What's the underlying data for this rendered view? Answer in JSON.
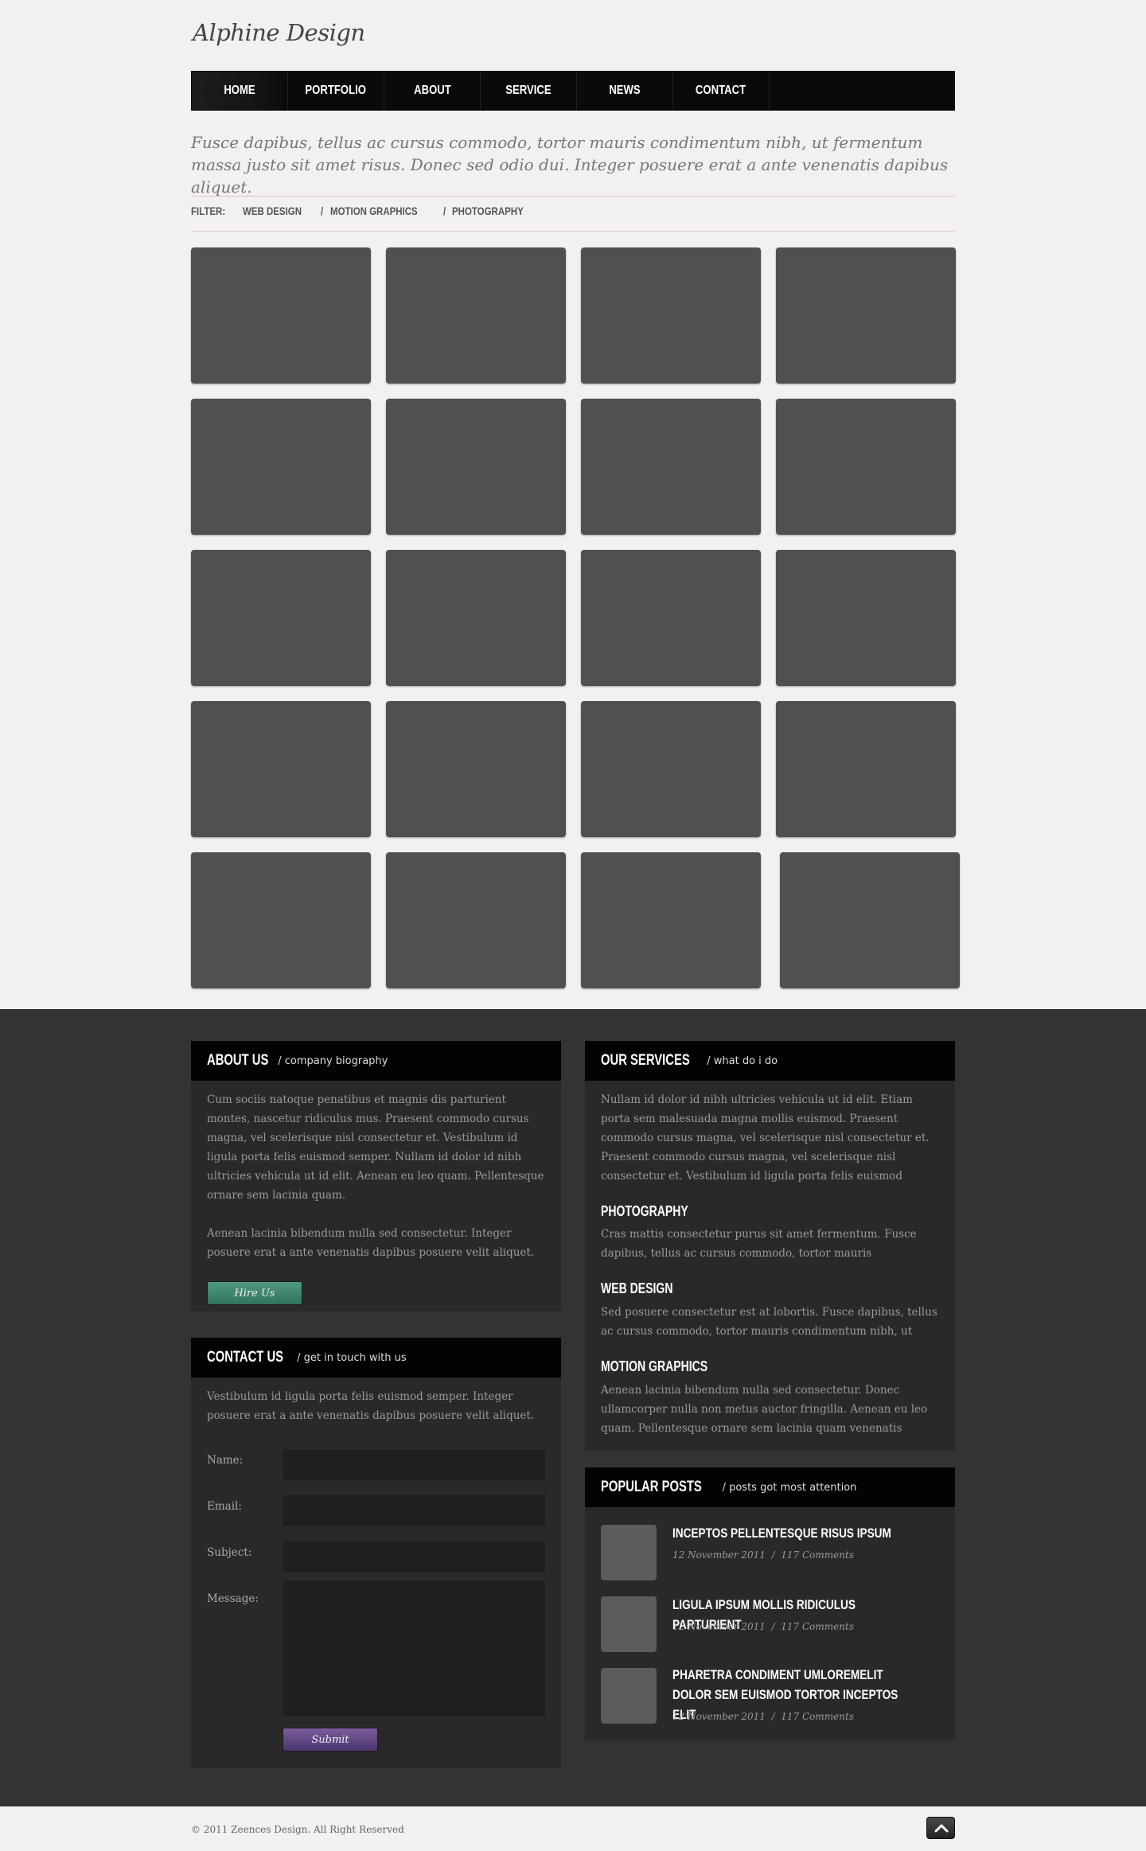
{
  "brand": {
    "logo": "Alphine Design"
  },
  "nav": {
    "items": [
      "HOME",
      "PORTFOLIO",
      "ABOUT",
      "SERVICE",
      "NEWS",
      "CONTACT"
    ],
    "active": "HOME"
  },
  "intro": {
    "text": "Fusce dapibus, tellus ac cursus commodo, tortor mauris condimentum nibh, ut fermentum massa justo sit amet risus. Donec sed odio dui. Integer posuere erat a ante venenatis dapibus aliquet."
  },
  "filter": {
    "label": "FILTER:",
    "options": [
      "WEB DESIGN",
      "MOTION GRAPHICS",
      "PHOTOGRAPHY"
    ],
    "separator": "/"
  },
  "about": {
    "title": "ABOUT US",
    "subtitle": "/  company biography",
    "p1": "Cum sociis natoque penatibus et magnis dis parturient montes, nascetur ridiculus mus. Praesent commodo cursus magna, vel scelerisque nisl consectetur et. Vestibulum id ligula porta felis euismod semper. Nullam id dolor id nibh ultricies vehicula ut id elit. Aenean eu leo quam. Pellentesque ornare sem lacinia quam.",
    "p2": "Aenean lacinia bibendum nulla sed consectetur. Integer posuere erat a ante venenatis dapibus posuere velit aliquet.",
    "button": "Hire Us"
  },
  "contact": {
    "title": "CONTACT US",
    "subtitle": "/  get in touch with us",
    "text": "Vestibulum id ligula porta felis euismod semper. Integer posuere erat a ante venenatis dapibus posuere velit aliquet.",
    "labels": {
      "name": "Name:",
      "email": "Email:",
      "subject": "Subject:",
      "message": "Message:"
    },
    "values": {
      "name": "",
      "email": "",
      "subject": "",
      "message": ""
    },
    "submit": "Submit"
  },
  "services": {
    "title": "OUR SERVICES",
    "subtitle": "/  what do i do",
    "intro": "Nullam id dolor id nibh ultricies vehicula ut id elit. Etiam porta sem malesuada magna mollis euismod. Praesent commodo cursus magna, vel scelerisque nisl consectetur et. Praesent commodo cursus magna, vel scelerisque nisl consectetur et. Vestibulum id ligula porta felis euismod",
    "items": [
      {
        "title": "PHOTOGRAPHY",
        "text": "Cras mattis consectetur purus sit amet fermentum. Fusce dapibus, tellus ac cursus commodo, tortor mauris"
      },
      {
        "title": "WEB DESIGN",
        "text": "Sed posuere consectetur est at lobortis. Fusce dapibus, tellus ac cursus commodo, tortor mauris condimentum nibh, ut"
      },
      {
        "title": "MOTION GRAPHICS",
        "text": "Aenean lacinia bibendum nulla sed consectetur. Donec ullamcorper nulla non metus auctor fringilla. Aenean eu leo quam. Pellentesque ornare sem lacinia quam venenatis"
      }
    ]
  },
  "popular": {
    "title": "POPULAR POSTS",
    "subtitle": "/  posts got most attention",
    "posts": [
      {
        "title": "INCEPTOS PELLENTESQUE RISUS IPSUM",
        "date": "12 November 2011",
        "sep": "/",
        "comments": "117 Comments"
      },
      {
        "title": "LIGULA IPSUM MOLLIS RIDICULUS PARTURIENT",
        "date": "12 November 2011",
        "sep": "/",
        "comments": "117 Comments"
      },
      {
        "title": "PHARETRA CONDIMENT UMLOREMELIT DOLOR SEM EUISMOD TORTOR INCEPTOS ELIT",
        "date": "12 November 2011",
        "sep": "/",
        "comments": "117 Comments"
      }
    ]
  },
  "footer": {
    "copyright": "© 2011 Zeences Design. All Right Reserved",
    "to_top_icon": "chevron-up-icon"
  },
  "colors": {
    "page_bg": "#f2f0f0",
    "footer_bg": "#333333",
    "panel_bg": "#292929",
    "tile": "#505050",
    "hire_button": "#3f8a6e",
    "submit_button": "#634a86"
  }
}
